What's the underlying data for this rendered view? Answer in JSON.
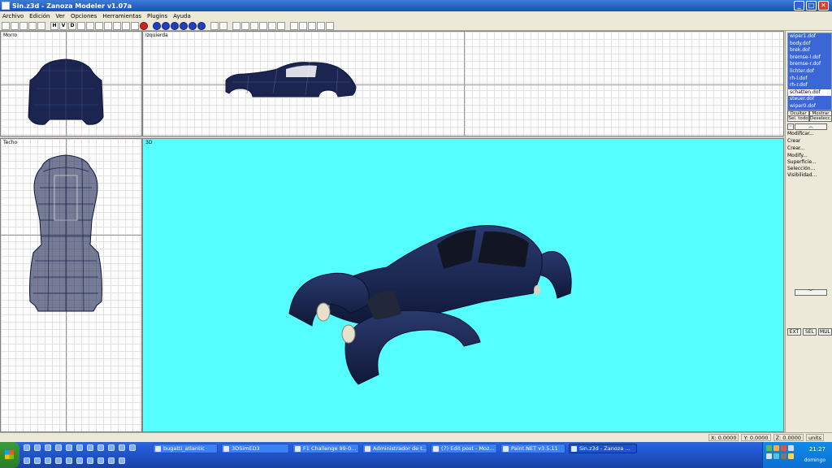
{
  "window": {
    "title": "Sin.z3d - Zanoza Modeler v1.07a",
    "min_label": "_",
    "max_label": "□",
    "close_label": "✕"
  },
  "menu": [
    "Archivo",
    "Edición",
    "Ver",
    "Opciones",
    "Herramientas",
    "Plugins",
    "Ayuda"
  ],
  "toolbar": {
    "letter_buttons": [
      "H",
      "V",
      "D"
    ]
  },
  "viewports": {
    "front": "Morro",
    "left": "Izquierda",
    "top": "Techo",
    "persp": "3D"
  },
  "panel": {
    "parts": [
      {
        "name": "wiper1.dof",
        "selected": true
      },
      {
        "name": "body.dof",
        "selected": true
      },
      {
        "name": "brek.dof",
        "selected": true
      },
      {
        "name": "bremse-l.dof",
        "selected": true
      },
      {
        "name": "bremse-r.dof",
        "selected": true
      },
      {
        "name": "lichter.dof",
        "selected": true
      },
      {
        "name": "rh-l.dof",
        "selected": true
      },
      {
        "name": "rh-r.dof",
        "selected": true
      },
      {
        "name": "schatten.dof",
        "selected": false
      },
      {
        "name": "steuer.dof",
        "selected": true
      },
      {
        "name": "wiper0.dof",
        "selected": true
      }
    ],
    "ocultar_label": "Ocultar todo",
    "mostrar_label": "Mostrar todo",
    "sel_all_label": "Sel. todo",
    "deselect_label": "Deselecc.",
    "items": [
      "Modificar...",
      "Crear",
      "Crear...",
      "Modify...",
      "Superficie...",
      "Selección...",
      "Visibilidad..."
    ],
    "mode_buttons": [
      "EXT",
      "SEL",
      "MUL"
    ]
  },
  "status": {
    "x": "X: 0.0000",
    "y": "Y: 0.0000",
    "z": "Z: 0.0000",
    "units": "units"
  },
  "taskbar": {
    "tasks": [
      {
        "label": "bugatti_atlantic",
        "active": false
      },
      {
        "label": "3DSimED3",
        "active": false
      },
      {
        "label": "F1 Challenge 99-0...",
        "active": false
      },
      {
        "label": "Administrador de t...",
        "active": false
      },
      {
        "label": "(7) Edit post - Moz...",
        "active": false
      },
      {
        "label": "Paint.NET v3.5.11",
        "active": false
      },
      {
        "label": "Sin.z3d - Zanoza ...",
        "active": true
      }
    ],
    "time": "21:27",
    "day": "domingo"
  },
  "colors": {
    "viewport_3d_bg": "#55ffff",
    "car_body": "#1c2a55",
    "wireframe": "#1b2550",
    "selection": "#3a67d5"
  }
}
